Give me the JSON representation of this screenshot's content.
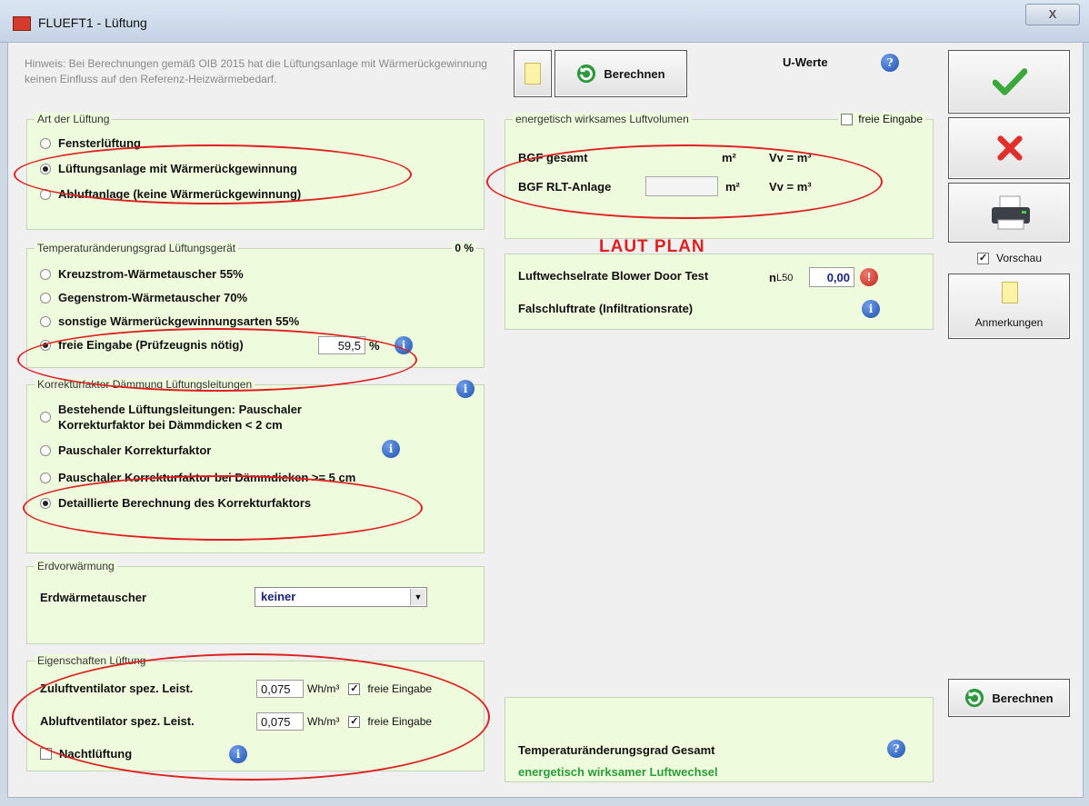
{
  "window": {
    "title": "FLUEFT1 - Lüftung",
    "close_label": "X"
  },
  "hint": "Hinweis: Bei Berechnungen gemäß OIB 2015 hat die Lüftungsanlage mit Wärmerückgewinnung keinen Einfluss auf den Referenz-Heizwärmebedarf.",
  "toolbar": {
    "berechnen_label": "Berechnen",
    "u_werte_label": "U-Werte"
  },
  "art": {
    "title": "Art der Lüftung",
    "options": [
      "Fensterlüftung",
      "Lüftungsanlage mit Wärmerückgewinnung",
      "Abluftanlage (keine Wärmerückgewinnung)"
    ],
    "selected": 1
  },
  "temp": {
    "title": "Temperaturänderungsgrad Lüftungsgerät",
    "value": "0 %",
    "options": [
      "Kreuzstrom-Wärmetauscher 55%",
      "Gegenstrom-Wärmetauscher 70%",
      "sonstige Wärmerückgewinnungsarten 55%",
      "freie Eingabe (Prüfzeugnis nötig)"
    ],
    "selected": 3,
    "input_value": "59,5",
    "unit": "%"
  },
  "korr": {
    "title": "Korrekturfaktor Dämmung Lüftungsleitungen",
    "options": [
      "Bestehende Lüftungsleitungen: Pauschaler Korrekturfaktor bei Dämmdicken < 2 cm",
      "Pauschaler Korrekturfaktor",
      "Pauschaler Korrekturfaktor bei Dämmdicken >= 5 cm",
      "Detaillierte Berechnung des Korrekturfaktors"
    ],
    "option0_line1": "Bestehende Lüftungsleitungen: Pauschaler",
    "option0_line2": "Korrekturfaktor bei Dämmdicken < 2 cm",
    "selected": 3
  },
  "erd": {
    "title": "Erdvorwärmung",
    "label": "Erdwärmetauscher",
    "value": "keiner"
  },
  "eig": {
    "title": "Eigenschaften Lüftung",
    "zuluft_label": "Zuluftventilator spez. Leist.",
    "zuluft_value": "0,075",
    "abluft_label": "Abluftventilator spez. Leist.",
    "abluft_value": "0,075",
    "unit": "Wh/m³",
    "freie_label": "freie Eingabe",
    "nacht_label": "Nachtlüftung"
  },
  "volumen": {
    "title": "energetisch wirksames Luftvolumen",
    "freie_label": "freie Eingabe",
    "bgf_gesamt_label": "BGF gesamt",
    "bgf_rlt_label": "BGF RLT-Anlage",
    "unit_m2": "m²",
    "vv_label": "Vv =",
    "unit_m3": "m³"
  },
  "annotation": "LAUT PLAN",
  "luftwechsel": {
    "blower_label": "Luftwechselrate Blower Door Test",
    "n_symbol": "n",
    "n_sub": "L50",
    "n_value": "0,00",
    "falschluft_label": "Falschluftrate (Infiltrationsrate)"
  },
  "gesamt": {
    "temp_label": "Temperaturänderungsgrad Gesamt",
    "luftwechsel_label": "energetisch wirksamer Luftwechsel"
  },
  "side": {
    "vorschau_label": "Vorschau",
    "anmerkungen_label": "Anmerkungen",
    "berechnen_label": "Berechnen"
  },
  "colors": {
    "annotation": "#e02020",
    "panel": "#eefbdc",
    "info": "#1f4fb0",
    "green_text": "#2a9d3a"
  }
}
